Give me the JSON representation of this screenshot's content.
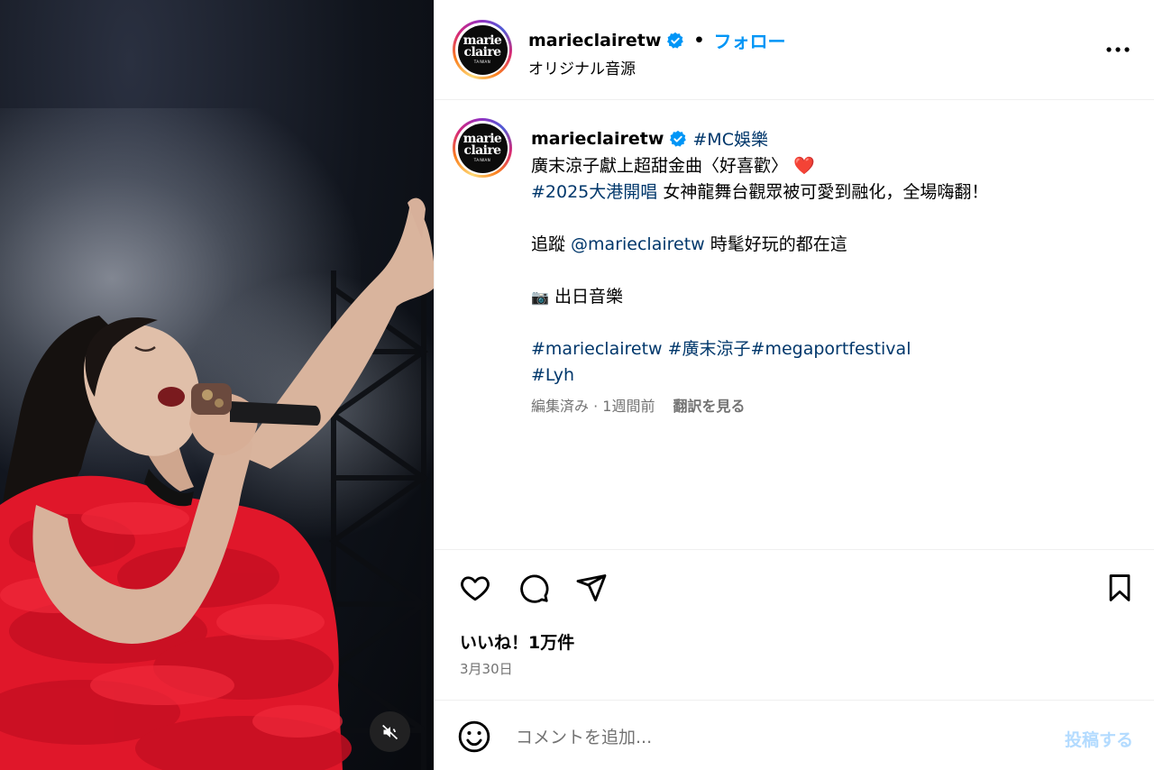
{
  "header": {
    "username": "marieclairetw",
    "separator": "•",
    "follow_label": "フォロー",
    "audio_label": "オリジナル音源"
  },
  "avatar": {
    "line1": "marie",
    "line2": "claire",
    "line3": "TAIWAN"
  },
  "caption": {
    "username": "marieclairetw",
    "tag_mc": "#MC娛樂",
    "line1": "廣末涼子獻上超甜金曲〈好喜歡〉",
    "heart_emoji": "❤️",
    "tag_concert": "#2025大港開唱",
    "line2_rest": " 女神龍舞台觀眾被可愛到融化，全場嗨翻！",
    "follow_prefix": "追蹤 ",
    "mention": "@marieclairetw",
    "follow_suffix": " 時髦好玩的都在這",
    "camera_emoji": "📷",
    "credit": " 出日音樂",
    "tags_line1": "#marieclairetw #廣末涼子#megaportfestival",
    "tags_line2": "#Lyh"
  },
  "meta": {
    "edited": "編集済み · 1週間前",
    "translate_label": "翻訳を見る"
  },
  "stats": {
    "likes": "いいね！1万件",
    "date": "3月30日"
  },
  "comment": {
    "placeholder": "コメントを追加...",
    "post_label": "投稿する"
  },
  "icons": {
    "verified": "verified-badge-icon",
    "more": "more-options-icon",
    "like": "heart-icon",
    "comment": "comment-bubble-icon",
    "share": "paper-plane-icon",
    "save": "bookmark-icon",
    "emoji": "smiley-icon",
    "mute": "speaker-muted-icon"
  },
  "colors": {
    "link": "#00376b",
    "follow": "#0095f6",
    "verified": "#0095f6",
    "dress": "#e0172a",
    "post_disabled": "#b3dbff"
  }
}
